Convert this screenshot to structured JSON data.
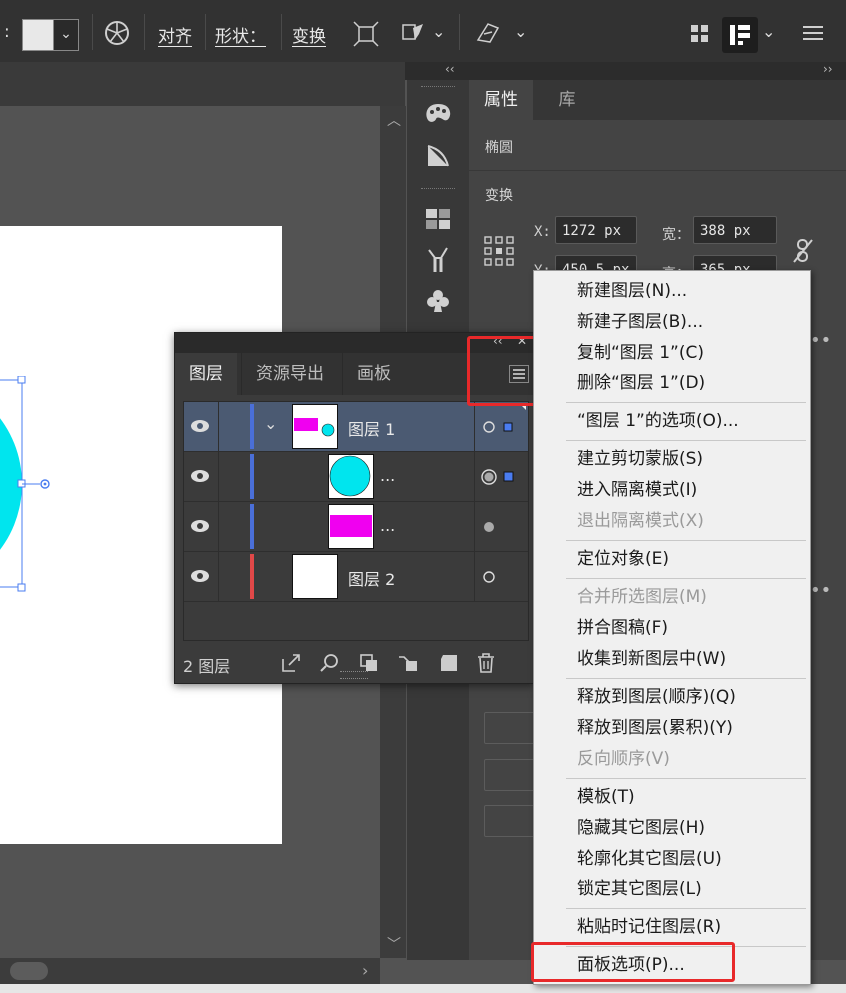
{
  "control_bar": {
    "colon": ":",
    "align_label": "对齐",
    "shape_label": "形状：",
    "transform_label": "变换"
  },
  "dock": {
    "collapse_left": "‹‹",
    "collapse_right": "››"
  },
  "properties_panel": {
    "tabs": [
      {
        "label": "属性"
      },
      {
        "label": "库"
      }
    ],
    "object_type": "椭圆",
    "section_transform": "变换",
    "x_label": "X:",
    "x_value": "1272 px",
    "y_label": "Y:",
    "y_value": "450.5 px",
    "width_label": "宽：",
    "width_value": "388 px",
    "height_label": "高：",
    "height_value": "365 px"
  },
  "layers_panel": {
    "collapse": "‹‹",
    "close": "✕",
    "tabs": [
      {
        "label": "图层"
      },
      {
        "label": "资源导出"
      },
      {
        "label": "画板"
      }
    ],
    "rows": [
      {
        "name": "图层 1",
        "color": "#4a6fd8"
      },
      {
        "name": "...",
        "color": "#4a6fd8"
      },
      {
        "name": "...",
        "color": "#4a6fd8"
      },
      {
        "name": "图层 2",
        "color": "#e04848"
      }
    ],
    "footer_count": "2 图层"
  },
  "context_menu": {
    "items": [
      {
        "label": "新建图层(N)...",
        "enabled": true
      },
      {
        "label": "新建子图层(B)...",
        "enabled": true
      },
      {
        "label": "复制“图层 1”(C)",
        "enabled": true
      },
      {
        "label": "删除“图层 1”(D)",
        "enabled": true
      },
      {
        "label": "“图层 1”的选项(O)...",
        "enabled": true
      },
      {
        "label": "建立剪切蒙版(S)",
        "enabled": true
      },
      {
        "label": "进入隔离模式(I)",
        "enabled": true
      },
      {
        "label": "退出隔离模式(X)",
        "enabled": false
      },
      {
        "label": "定位对象(E)",
        "enabled": true
      },
      {
        "label": "合并所选图层(M)",
        "enabled": false
      },
      {
        "label": "拼合图稿(F)",
        "enabled": true
      },
      {
        "label": "收集到新图层中(W)",
        "enabled": true
      },
      {
        "label": "释放到图层(顺序)(Q)",
        "enabled": true
      },
      {
        "label": "释放到图层(累积)(Y)",
        "enabled": true
      },
      {
        "label": "反向顺序(V)",
        "enabled": false
      },
      {
        "label": "模板(T)",
        "enabled": true
      },
      {
        "label": "隐藏其它图层(H)",
        "enabled": true
      },
      {
        "label": "轮廓化其它图层(U)",
        "enabled": true
      },
      {
        "label": "锁定其它图层(L)",
        "enabled": true
      },
      {
        "label": "粘贴时记住图层(R)",
        "enabled": true
      },
      {
        "label": "面板选项(P)...",
        "enabled": true
      }
    ]
  },
  "colors": {
    "selection_accent": "#4a7cf0",
    "ellipse_fill": "#00e5ee",
    "rect_fill": "#f000f0",
    "highlight_box": "#e8292a"
  }
}
